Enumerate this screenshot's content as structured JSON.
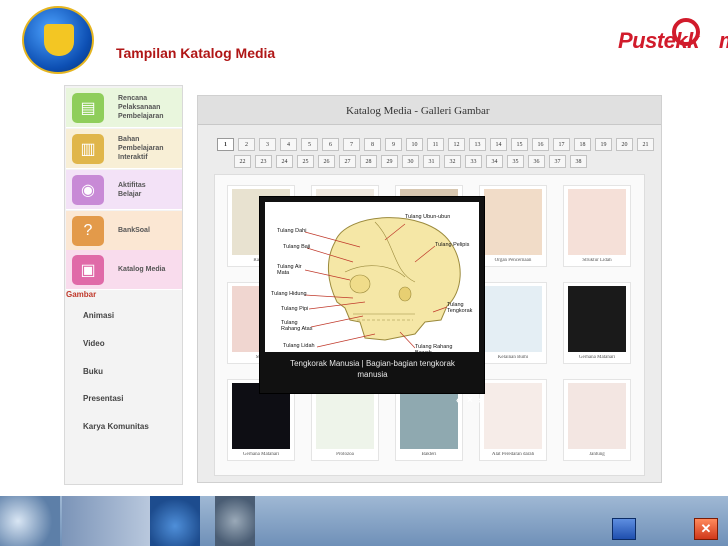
{
  "header": {
    "page_title": "Tampilan Katalog Media",
    "brand": "Pustekk",
    "brand_suffix": "m"
  },
  "sidebar": {
    "items": [
      {
        "label": "Rencana\nPelaksanaan\nPembelajaran",
        "icon": "book-stack-icon",
        "color": "#8fce5b"
      },
      {
        "label": "Bahan\nPembelajaran\nInteraktif",
        "icon": "open-book-icon",
        "color": "#e0b64a"
      },
      {
        "label": "Aktifitas\nBelajar",
        "icon": "activity-globe-icon",
        "color": "#c88ad6"
      },
      {
        "label": "BankSoal",
        "icon": "question-bank-icon",
        "color": "#e39a4a"
      },
      {
        "label": "Katalog Media",
        "icon": "media-catalog-icon",
        "color": "#e06aa8"
      }
    ],
    "section_label": "Gambar",
    "sub_items": [
      "Animasi",
      "Video",
      "Buku",
      "Presentasi",
      "Karya Komunitas"
    ]
  },
  "main": {
    "title": "Katalog Media - Galleri Gambar",
    "pages_row1": [
      "1",
      "2",
      "3",
      "4",
      "5",
      "6",
      "7",
      "8",
      "9",
      "10",
      "11",
      "12",
      "13",
      "14",
      "15",
      "16",
      "17",
      "18",
      "19",
      "20",
      "21"
    ],
    "pages_row2": [
      "22",
      "23",
      "24",
      "25",
      "26",
      "27",
      "28",
      "29",
      "30",
      "31",
      "32",
      "33",
      "34",
      "35",
      "36",
      "37",
      "38"
    ],
    "active_page": "1",
    "gallery": [
      {
        "caption": "Rangka",
        "color": "#e8e2d0"
      },
      {
        "caption": "",
        "color": "#efe9e0"
      },
      {
        "caption": "",
        "color": "#d8c7b0"
      },
      {
        "caption": "Organ Pencernaan",
        "color": "#f1dcc8"
      },
      {
        "caption": "Struktur Lidah",
        "color": "#f5e0d8"
      },
      {
        "caption": "Struk",
        "color": "#f0d6d0"
      },
      {
        "caption": "",
        "color": "#f4f0e8"
      },
      {
        "caption": "",
        "color": "#e9e4dc"
      },
      {
        "caption": "Kelainan Bumi",
        "color": "#e4eef4"
      },
      {
        "caption": "Gerhana Matahari",
        "color": "#1a1a1a"
      },
      {
        "caption": "Gerhana Matahari",
        "color": "#0e0e14"
      },
      {
        "caption": "Protozoa",
        "color": "#eef4ea"
      },
      {
        "caption": "Bakteri",
        "color": "#8fa9b0"
      },
      {
        "caption": "Alat Peredaran darah",
        "color": "#f6ece8"
      },
      {
        "caption": "Jantung",
        "color": "#f3e6e2"
      }
    ]
  },
  "lightbox": {
    "labels": [
      "Tulang Ubun-ubun",
      "Tulang Dahi",
      "Tulang Baji",
      "Tulang Pelipis",
      "Tulang Air Mata",
      "Tulang Hidung",
      "Tulang Pipi",
      "Tulang Rahang Atas",
      "Tulang Tengkorak",
      "Tulang Lidah",
      "Tulang Rahang Bawah"
    ],
    "caption": "Tengkorak Manusia | Bagian-bagian tengkorak manusia",
    "nav_prev": "‹",
    "nav_close": "×",
    "nav_next": "›"
  },
  "footer": {
    "nav_icon": "next-slide-icon",
    "close_icon": "close-icon",
    "close_label": "✕"
  }
}
